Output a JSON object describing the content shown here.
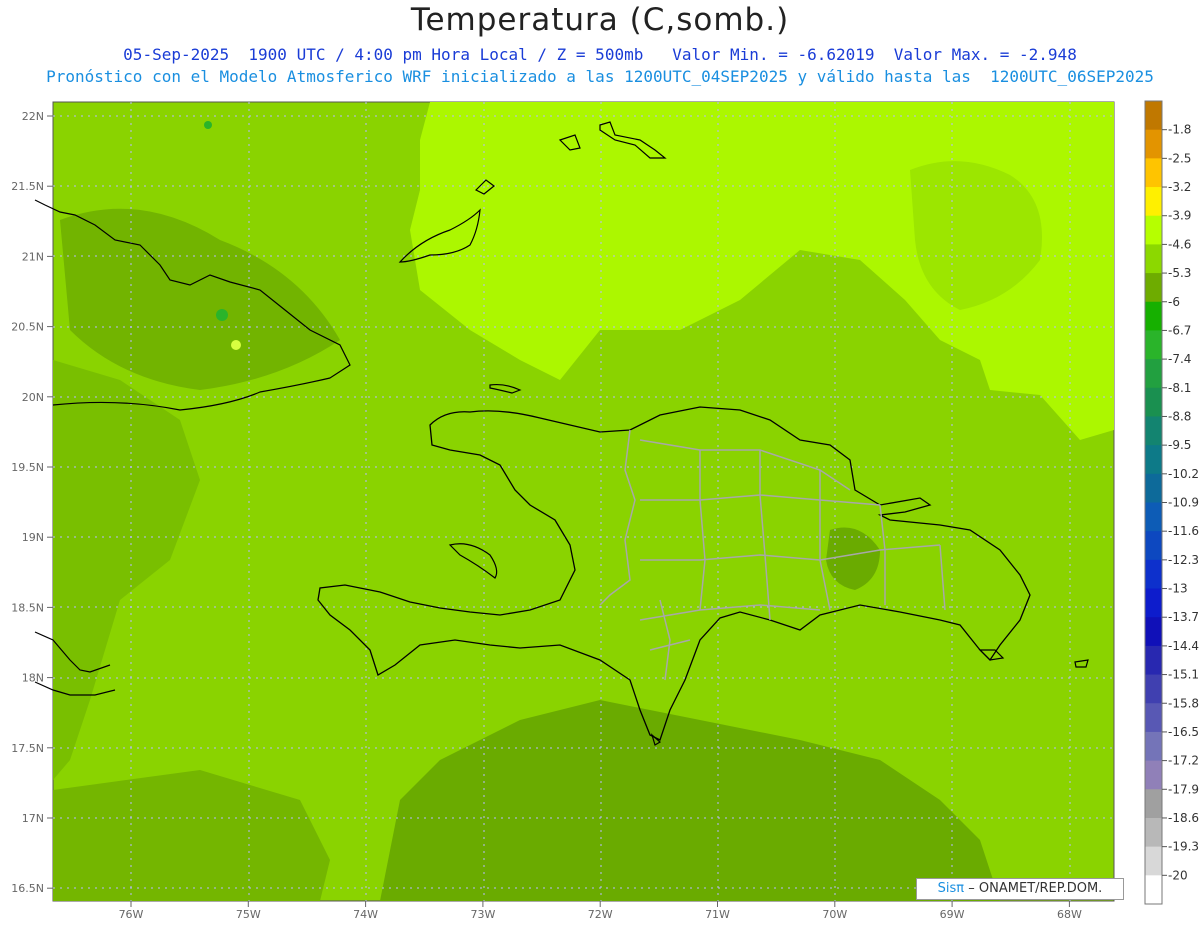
{
  "header": {
    "title": "Temperatura (C,somb.)",
    "line1": "05-Sep-2025  1900 UTC / 4:00 pm Hora Local / Z = 500mb   Valor Min. = -6.62019  Valor Max. = -2.948",
    "line2": "Pronóstico con el Modelo Atmosferico WRF inicializado a las 1200UTC_04SEP2025 y válido hasta las  1200UTC_06SEP2025"
  },
  "axes": {
    "lat_labels": [
      "22N",
      "21.5N",
      "21N",
      "20.5N",
      "20N",
      "19.5N",
      "19N",
      "18.5N",
      "18N",
      "17.5N",
      "17N",
      "16.5N"
    ],
    "lon_labels": [
      "76W",
      "75W",
      "74W",
      "73W",
      "72W",
      "71W",
      "70W",
      "69W",
      "68W"
    ]
  },
  "colorbar": {
    "labels": [
      "-1.8",
      "-2.5",
      "-3.2",
      "-3.9",
      "-4.6",
      "-5.3",
      "-6",
      "-6.7",
      "-7.4",
      "-8.1",
      "-8.8",
      "-9.5",
      "-10.2",
      "-10.9",
      "-11.6",
      "-12.3",
      "-13",
      "-13.7",
      "-14.4",
      "-15.1",
      "-15.8",
      "-16.5",
      "-17.2",
      "-17.9",
      "-18.6",
      "-19.3",
      "-20"
    ],
    "colors": [
      "#c07800",
      "#e39400",
      "#ffc400",
      "#fff000",
      "#b6ff00",
      "#8cd800",
      "#6eac00",
      "#16b000",
      "#2ab42a",
      "#22a040",
      "#1a9050",
      "#138470",
      "#0d7a88",
      "#0d6a9a",
      "#0d5cb6",
      "#0d48c0",
      "#0d30cc",
      "#0d1ccc",
      "#1010b8",
      "#2828b0",
      "#4040b0",
      "#5858b4",
      "#7474b8",
      "#9080b8",
      "#a0a0a0",
      "#b8b8b8",
      "#d8d8d8",
      "#ffffff"
    ]
  },
  "map_colors": {
    "base": "#8ad300",
    "light": "#acf700",
    "dark": "#6aab00",
    "deep": "#16b000",
    "land_border": "#000000",
    "province_border": "#a0a0a0"
  },
  "credit": {
    "logo": "Sisπ",
    "text": "– ONAMET/REP.DOM."
  }
}
